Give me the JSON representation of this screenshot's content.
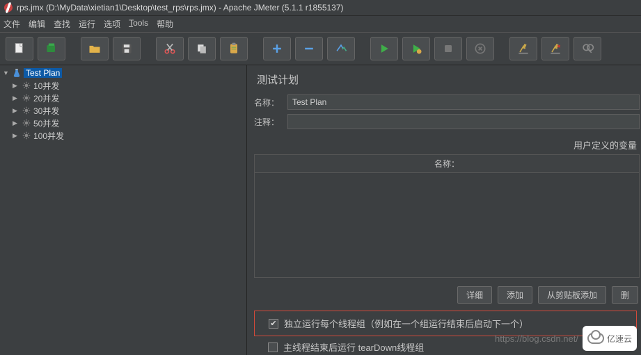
{
  "window": {
    "title": "rps.jmx (D:\\MyData\\xietian1\\Desktop\\test_rps\\rps.jmx) - Apache JMeter (5.1.1 r1855137)"
  },
  "menu": {
    "file": "文件",
    "edit": "编辑",
    "search": "查找",
    "run": "运行",
    "options": "选项",
    "tools": "Tools",
    "help": "帮助"
  },
  "tree": {
    "root": "Test Plan",
    "items": [
      {
        "label": "10并发"
      },
      {
        "label": "20并发"
      },
      {
        "label": "30并发"
      },
      {
        "label": "50并发"
      },
      {
        "label": "100并发"
      }
    ]
  },
  "panel": {
    "title": "测试计划",
    "name_label": "名称：",
    "name_value": "Test Plan",
    "comment_label": "注释：",
    "comment_value": "",
    "vars_title": "用户定义的变量",
    "col_name": "名称：",
    "buttons": {
      "detail": "详细",
      "add": "添加",
      "from_clip": "从剪贴板添加",
      "delete": "删"
    },
    "chk1": "独立运行每个线程组（例如在一个组运行结束后启动下一个）",
    "chk2": "主线程结束后运行 tearDown线程组"
  },
  "watermark": "https://blog.csdn.net/",
  "badge": "亿速云"
}
